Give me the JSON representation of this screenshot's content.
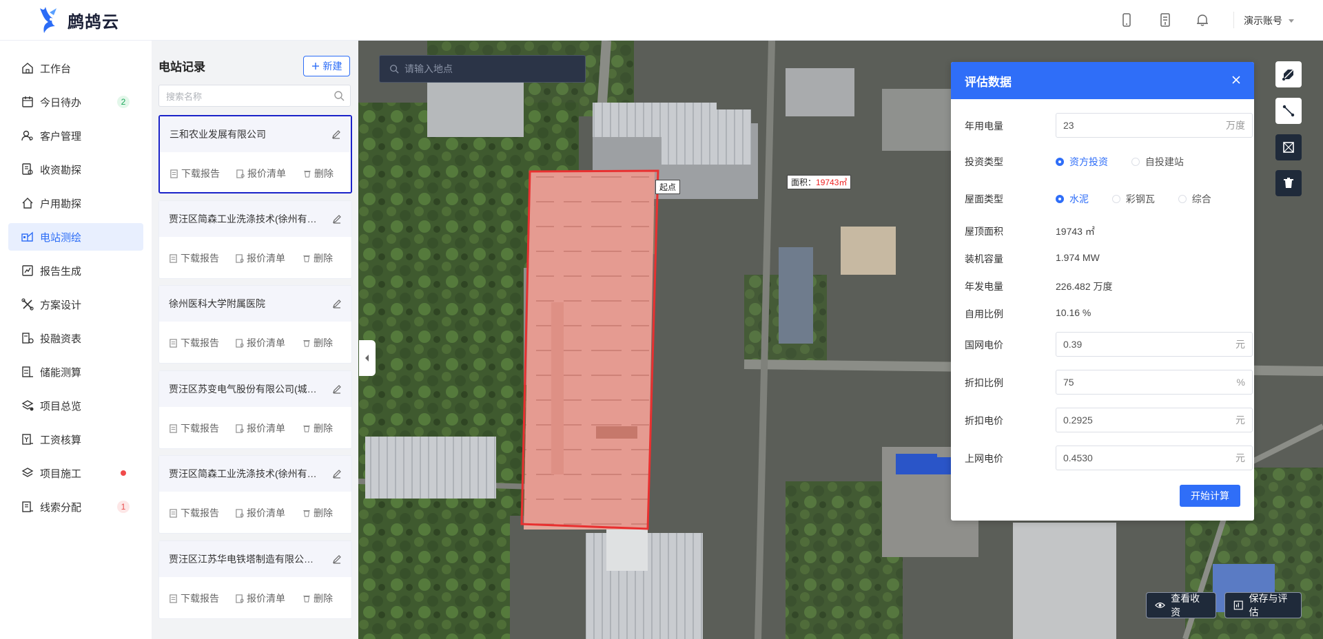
{
  "app": {
    "name": "鹧鸪云",
    "account": "演示账号"
  },
  "colors": {
    "primary": "#2f6ef8",
    "sidebar_active_bg": "#e8effe",
    "selected_card_border": "#1a22c9",
    "outline": "#e83030"
  },
  "topbar": {
    "icons": [
      "phone-icon",
      "document-icon",
      "bell-icon"
    ]
  },
  "sidebar": {
    "items": [
      {
        "label": "工作台",
        "icon": "home-icon"
      },
      {
        "label": "今日待办",
        "icon": "calendar-icon",
        "badge": "2"
      },
      {
        "label": "客户管理",
        "icon": "users-icon"
      },
      {
        "label": "收资勘探",
        "icon": "document-search-icon"
      },
      {
        "label": "户用勘探",
        "icon": "house-icon"
      },
      {
        "label": "电站测绘",
        "icon": "survey-icon",
        "active": true
      },
      {
        "label": "报告生成",
        "icon": "chart-report-icon"
      },
      {
        "label": "方案设计",
        "icon": "tools-icon"
      },
      {
        "label": "投融资表",
        "icon": "finance-icon"
      },
      {
        "label": "储能测算",
        "icon": "battery-calc-icon"
      },
      {
        "label": "项目总览",
        "icon": "layers-icon"
      },
      {
        "label": "工资核算",
        "icon": "salary-icon"
      },
      {
        "label": "项目施工",
        "icon": "construction-icon",
        "dot": true
      },
      {
        "label": "线索分配",
        "icon": "clue-icon",
        "badge": "1"
      }
    ]
  },
  "stations": {
    "title": "电站记录",
    "new_label": "新建",
    "search_placeholder": "搜索名称",
    "actions": {
      "download": "下载报告",
      "quote": "报价清单",
      "delete": "删除"
    },
    "cards": [
      {
        "name": "三和农业发展有限公司",
        "selected": true
      },
      {
        "name": "贾汪区简森工业洗涤技术(徐州有限公司)"
      },
      {
        "name": "徐州医科大学附属医院"
      },
      {
        "name": "贾汪区苏变电气股份有限公司(城东分公司)"
      },
      {
        "name": "贾汪区简森工业洗涤技术(徐州有限公司)"
      },
      {
        "name": "贾汪区江苏华电铁塔制造有限公司贾汪分公司"
      }
    ]
  },
  "map": {
    "search_placeholder": "请输入地点",
    "start_label": "起点",
    "area_label": "面积：",
    "area_value": "19743㎡",
    "tools": [
      "draw-polygon-icon",
      "measure-line-icon",
      "select-area-icon",
      "trash-icon"
    ],
    "view_btn": "查看收资",
    "save_btn": "保存与评估"
  },
  "eval": {
    "title": "评估数据",
    "annual_usage": {
      "label": "年用电量",
      "value": "23",
      "unit": "万度"
    },
    "invest_type": {
      "label": "投资类型",
      "options": [
        "资方投资",
        "自投建站"
      ],
      "selected": 0
    },
    "roof_type": {
      "label": "屋面类型",
      "options": [
        "水泥",
        "彩钢瓦",
        "综合"
      ],
      "selected": 0
    },
    "roof_area": {
      "label": "屋顶面积",
      "value": "19743 ㎡"
    },
    "capacity": {
      "label": "装机容量",
      "value": "1.974 MW"
    },
    "annual_gen": {
      "label": "年发电量",
      "value": "226.482 万度"
    },
    "self_ratio": {
      "label": "自用比例",
      "value": "10.16 %"
    },
    "grid_price": {
      "label": "国网电价",
      "value": "0.39",
      "unit": "元"
    },
    "discount_ratio": {
      "label": "折扣比例",
      "value": "75",
      "unit": "%"
    },
    "discount_price": {
      "label": "折扣电价",
      "value": "0.2925",
      "unit": "元"
    },
    "feed_price": {
      "label": "上网电价",
      "value": "0.4530",
      "unit": "元"
    },
    "calc_btn": "开始计算"
  }
}
